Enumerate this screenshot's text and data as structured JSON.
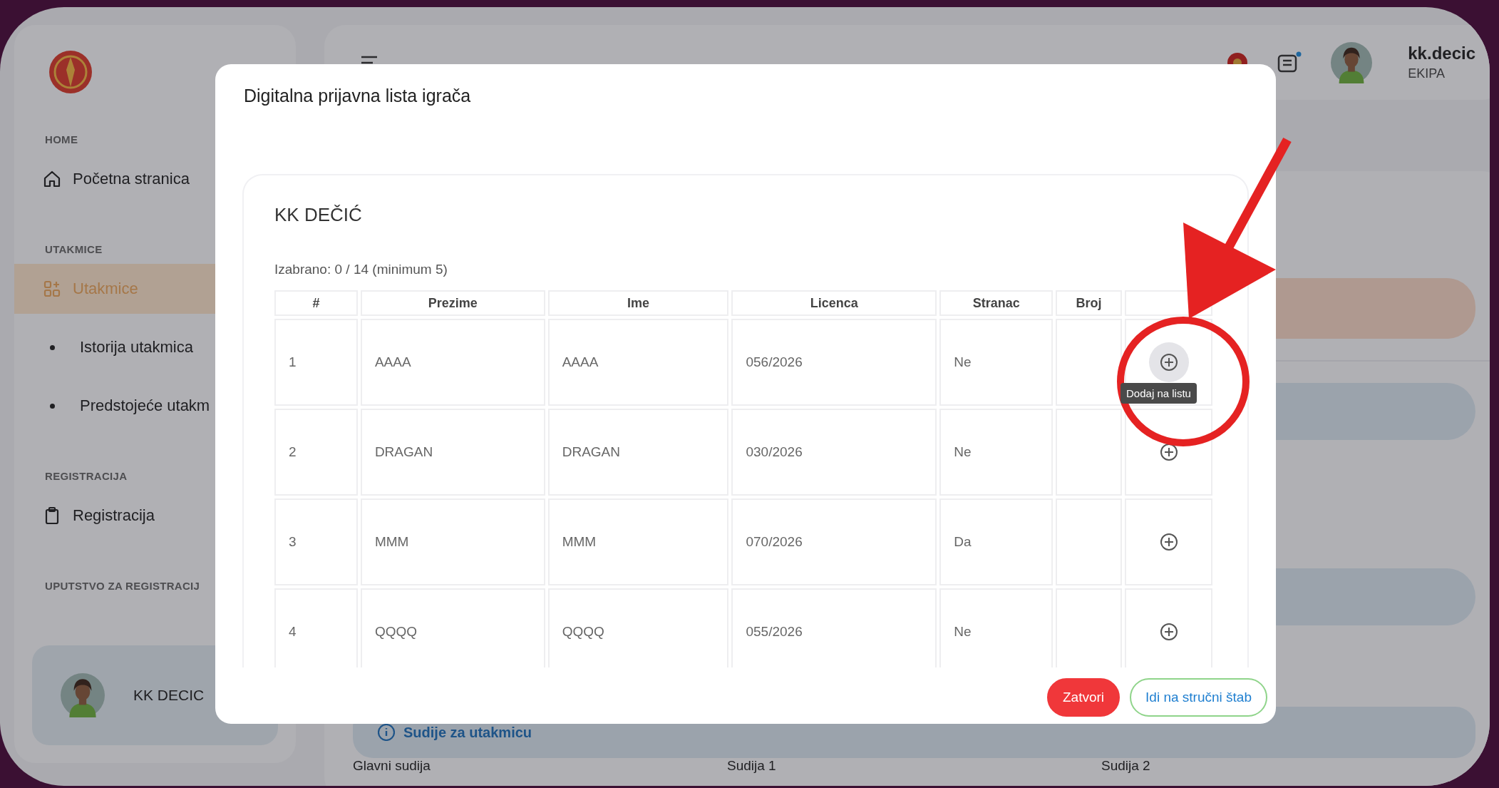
{
  "sidebar": {
    "sections": [
      {
        "label": "HOME",
        "items": [
          {
            "label": "Početna stranica",
            "kind": "home",
            "selected": false
          }
        ]
      },
      {
        "label": "UTAKMICE",
        "items": [
          {
            "label": "Utakmice",
            "kind": "grid",
            "selected": true
          },
          {
            "label": "Istorija utakmica",
            "kind": "dot",
            "selected": false
          },
          {
            "label": "Predstojeće utakm",
            "kind": "dot",
            "selected": false
          }
        ]
      },
      {
        "label": "REGISTRACIJA",
        "items": [
          {
            "label": "Registracija",
            "kind": "clipboard",
            "selected": false
          }
        ]
      },
      {
        "label": "UPUTSTVO ZA REGISTRACIJ"
      }
    ],
    "team": {
      "name": "KK DECIC"
    }
  },
  "header": {
    "user": {
      "name": "kk.decic",
      "role": "EKIPA"
    },
    "notification_dot": true
  },
  "main": {
    "referees_section": {
      "title": "Sudije za utakmicu"
    },
    "referee_labels": [
      "Glavni sudija",
      "Sudija 1",
      "Sudija 2"
    ]
  },
  "modal": {
    "title": "Digitalna prijavna lista igrača",
    "team": "KK DEČIĆ",
    "selection": "Izabrano: 0 / 14 (minimum 5)",
    "columns": [
      "#",
      "Prezime",
      "Ime",
      "Licenca",
      "Stranac",
      "Broj"
    ],
    "rows": [
      {
        "number": "1",
        "surname": "AAAA",
        "name": "AAAA",
        "license": "056/2026",
        "foreigner": "Ne",
        "hovered": true,
        "tooltip": "Dodaj na listu"
      },
      {
        "number": "2",
        "surname": "DRAGAN",
        "name": "DRAGAN",
        "license": "030/2026",
        "foreigner": "Ne",
        "hovered": false
      },
      {
        "number": "3",
        "surname": "MMM",
        "name": "MMM",
        "license": "070/2026",
        "foreigner": "Da",
        "hovered": false
      },
      {
        "number": "4",
        "surname": "QQQQ",
        "name": "QQQQ",
        "license": "055/2026",
        "foreigner": "Ne",
        "hovered": false
      }
    ],
    "buttons": [
      {
        "label": "Zatvori",
        "kind": "danger"
      },
      {
        "label": "Idi na stručni štab",
        "kind": "outline"
      }
    ]
  }
}
